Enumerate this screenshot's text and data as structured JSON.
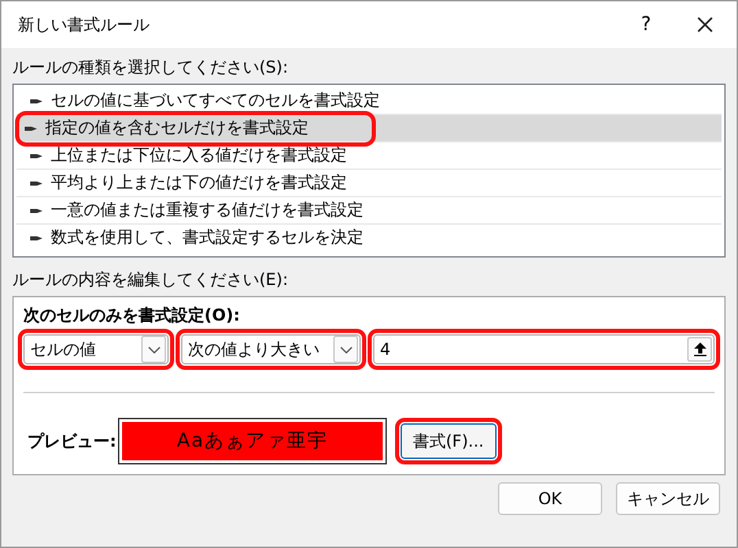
{
  "window": {
    "title": "新しい書式ルール",
    "help": "?"
  },
  "rule_type_label": "ルールの種類を選択してください(S):",
  "rule_types": [
    {
      "label": "セルの値に基づいてすべてのセルを書式設定",
      "selected": false,
      "highlighted": false
    },
    {
      "label": "指定の値を含むセルだけを書式設定",
      "selected": true,
      "highlighted": true
    },
    {
      "label": "上位または下位に入る値だけを書式設定",
      "selected": false,
      "highlighted": false
    },
    {
      "label": "平均より上または下の値だけを書式設定",
      "selected": false,
      "highlighted": false
    },
    {
      "label": "一意の値または重複する値だけを書式設定",
      "selected": false,
      "highlighted": false
    },
    {
      "label": "数式を使用して、書式設定するセルを決定",
      "selected": false,
      "highlighted": false
    }
  ],
  "edit_label": "ルールの内容を編集してください(E):",
  "condition_heading": "次のセルのみを書式設定(O):",
  "condition": [
    {
      "kind": "dropdown",
      "value": "セルの値",
      "highlighted": true
    },
    {
      "kind": "dropdown",
      "value": "次の値より大きい",
      "highlighted": true
    },
    {
      "kind": "input",
      "value": "4",
      "highlighted": true
    }
  ],
  "preview": {
    "label": "プレビュー:",
    "sample": "Aaあぁアァ亜宇",
    "color": "#ff0000"
  },
  "format_button": {
    "label": "書式(F)...",
    "highlighted": true
  },
  "buttons": [
    {
      "label": "OK"
    },
    {
      "label": "キャンセル"
    }
  ]
}
